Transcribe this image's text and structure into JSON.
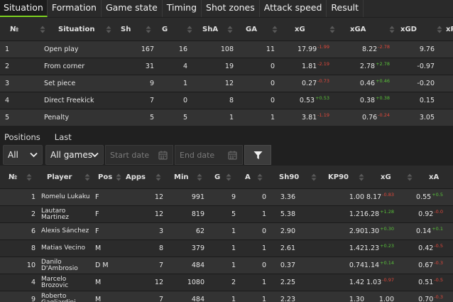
{
  "tabs": [
    "Situation",
    "Formation",
    "Game state",
    "Timing",
    "Shot zones",
    "Attack speed",
    "Result"
  ],
  "situation_table": {
    "headers": [
      "№",
      "Situation",
      "Sh",
      "G",
      "ShA",
      "GA",
      "xG",
      "xGA",
      "xGD",
      "xP"
    ],
    "rows": [
      {
        "n": "1",
        "situation": "Open play",
        "sh": "167",
        "g": "16",
        "sha": "108",
        "ga": "11",
        "xg": "17.99",
        "xg_d": "-1.99",
        "xga": "8.22",
        "xga_d": "-2.78",
        "xgd": "9.76"
      },
      {
        "n": "2",
        "situation": "From corner",
        "sh": "31",
        "g": "4",
        "sha": "19",
        "ga": "0",
        "xg": "1.81",
        "xg_d": "-2.19",
        "xga": "2.78",
        "xga_d": "+2.78",
        "xgd": "-0.97"
      },
      {
        "n": "3",
        "situation": "Set piece",
        "sh": "9",
        "g": "1",
        "sha": "12",
        "ga": "0",
        "xg": "0.27",
        "xg_d": "-0.73",
        "xga": "0.46",
        "xga_d": "+0.46",
        "xgd": "-0.20"
      },
      {
        "n": "4",
        "situation": "Direct Freekick",
        "sh": "7",
        "g": "0",
        "sha": "8",
        "ga": "0",
        "xg": "0.53",
        "xg_d": "+0.53",
        "xga": "0.38",
        "xga_d": "+0.38",
        "xgd": "0.15"
      },
      {
        "n": "5",
        "situation": "Penalty",
        "sh": "5",
        "g": "5",
        "sha": "1",
        "ga": "1",
        "xg": "3.81",
        "xg_d": "-1.19",
        "xga": "0.76",
        "xga_d": "-0.24",
        "xgd": "3.05"
      }
    ]
  },
  "section_tabs": [
    "Positions",
    "Last"
  ],
  "filters": {
    "position": "All",
    "games": "All games",
    "start_placeholder": "Start date",
    "end_placeholder": "End date"
  },
  "player_table": {
    "headers": [
      "№",
      "Player",
      "Pos",
      "Apps",
      "Min",
      "G",
      "A",
      "Sh90",
      "KP90",
      "xG",
      "xA"
    ],
    "rows": [
      {
        "n": "1",
        "player": "Romelu Lukaku",
        "pos": "F",
        "apps": "12",
        "min": "991",
        "g": "9",
        "a": "0",
        "sh90": "3.36",
        "kp90": "1.00",
        "xg": "8.17",
        "xg_d": "-0.83",
        "xa": "0.55",
        "xa_d": "+0.5"
      },
      {
        "n": "2",
        "player": "Lautaro Martinez",
        "pos": "F",
        "apps": "12",
        "min": "819",
        "g": "5",
        "a": "1",
        "sh90": "5.38",
        "kp90": "1.21",
        "xg": "6.28",
        "xg_d": "+1.28",
        "xa": "0.92",
        "xa_d": "-0.0"
      },
      {
        "n": "6",
        "player": "Alexis Sánchez",
        "pos": "F",
        "apps": "3",
        "min": "62",
        "g": "1",
        "a": "0",
        "sh90": "2.90",
        "kp90": "2.90",
        "xg": "1.30",
        "xg_d": "+0.30",
        "xa": "0.14",
        "xa_d": "+0.1"
      },
      {
        "n": "8",
        "player": "Matias Vecino",
        "pos": "M",
        "apps": "8",
        "min": "379",
        "g": "1",
        "a": "1",
        "sh90": "2.61",
        "kp90": "1.42",
        "xg": "1.23",
        "xg_d": "+0.23",
        "xa": "0.42",
        "xa_d": "-0.5"
      },
      {
        "n": "10",
        "player": "Danilo D'Ambrosio",
        "pos": "D M",
        "apps": "7",
        "min": "484",
        "g": "1",
        "a": "0",
        "sh90": "0.37",
        "kp90": "0.74",
        "xg": "1.14",
        "xg_d": "+0.14",
        "xa": "0.67",
        "xa_d": "-0.3"
      },
      {
        "n": "4",
        "player": "Marcelo Brozovic",
        "pos": "M",
        "apps": "12",
        "min": "1080",
        "g": "2",
        "a": "1",
        "sh90": "2.25",
        "kp90": "1.42",
        "xg": "1.03",
        "xg_d": "-0.97",
        "xa": "0.51",
        "xa_d": "-0.5"
      },
      {
        "n": "9",
        "player": "Roberto Gagliardini",
        "pos": "M",
        "apps": "7",
        "min": "484",
        "g": "1",
        "a": "1",
        "sh90": "2.23",
        "kp90": "1.30",
        "xg": "1.00",
        "xg_d": "",
        "xa": "0.70",
        "xa_d": "-0.3"
      }
    ]
  },
  "colors": {
    "accent": "#7ed321",
    "positive": "#59c13a",
    "negative": "#e0483b"
  },
  "icons": [
    "sort-arrows-icon",
    "chevron-down-icon",
    "calendar-icon",
    "filter-funnel-icon"
  ]
}
